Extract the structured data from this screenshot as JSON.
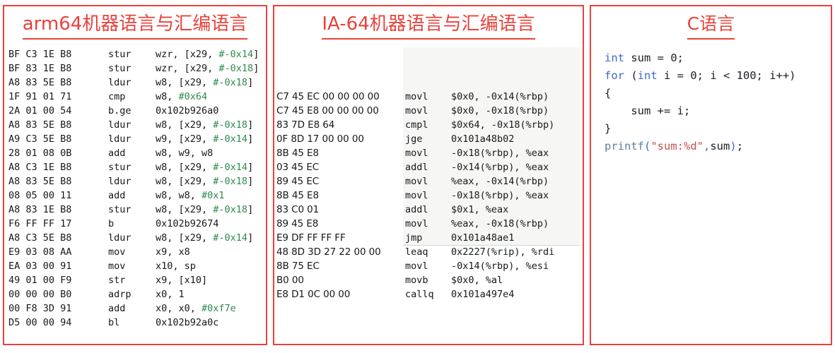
{
  "panels": {
    "arm64": {
      "title": "arm64机器语言与汇编语言",
      "lines": [
        {
          "hex": "BF C3 1E B8",
          "mnem": "stur",
          "ops": "wzr, [x29, ",
          "imm": "#-0x14",
          "tail": "]"
        },
        {
          "hex": "BF 83 1E B8",
          "mnem": "stur",
          "ops": "wzr, [x29, ",
          "imm": "#-0x18",
          "tail": "]"
        },
        {
          "hex": "A8 83 5E B8",
          "mnem": "ldur",
          "ops": "w8, [x29, ",
          "imm": "#-0x18",
          "tail": "]"
        },
        {
          "hex": "1F 91 01 71",
          "mnem": "cmp",
          "ops": "w8, ",
          "imm": "#0x64",
          "tail": ""
        },
        {
          "hex": "2A 01 00 54",
          "mnem": "b.ge",
          "ops": "0x102b926a0",
          "imm": "",
          "tail": ""
        },
        {
          "hex": "A8 83 5E B8",
          "mnem": "ldur",
          "ops": "w8, [x29, ",
          "imm": "#-0x18",
          "tail": "]"
        },
        {
          "hex": "A9 C3 5E B8",
          "mnem": "ldur",
          "ops": "w9, [x29, ",
          "imm": "#-0x14",
          "tail": "]"
        },
        {
          "hex": "28 01 08 0B",
          "mnem": "add",
          "ops": "w8, w9, w8",
          "imm": "",
          "tail": ""
        },
        {
          "hex": "A8 C3 1E B8",
          "mnem": "stur",
          "ops": "w8, [x29, ",
          "imm": "#-0x14",
          "tail": "]"
        },
        {
          "hex": "A8 83 5E B8",
          "mnem": "ldur",
          "ops": "w8, [x29, ",
          "imm": "#-0x18",
          "tail": "]"
        },
        {
          "hex": "08 05 00 11",
          "mnem": "add",
          "ops": "w8, w8, ",
          "imm": "#0x1",
          "tail": ""
        },
        {
          "hex": "A8 83 1E B8",
          "mnem": "stur",
          "ops": "w8, [x29, ",
          "imm": "#-0x18",
          "tail": "]"
        },
        {
          "hex": "F6 FF FF 17",
          "mnem": "b",
          "ops": "0x102b92674",
          "imm": "",
          "tail": ""
        },
        {
          "hex": "A8 C3 5E B8",
          "mnem": "ldur",
          "ops": "w8, [x29, ",
          "imm": "#-0x14",
          "tail": "]"
        },
        {
          "hex": "E9 03 08 AA",
          "mnem": "mov",
          "ops": "x9, x8",
          "imm": "",
          "tail": ""
        },
        {
          "hex": "EA 03 00 91",
          "mnem": "mov",
          "ops": "x10, sp",
          "imm": "",
          "tail": ""
        },
        {
          "hex": "49 01 00 F9",
          "mnem": "str",
          "ops": "x9, [x10]",
          "imm": "",
          "tail": ""
        },
        {
          "hex": "00 00 00 B0",
          "mnem": "adrp",
          "ops": "x0, 1",
          "imm": "",
          "tail": ""
        },
        {
          "hex": "00 F8 3D 91",
          "mnem": "add",
          "ops": "x0, x0, ",
          "imm": "#0xf7e",
          "tail": ""
        },
        {
          "hex": "D5 00 00 94",
          "mnem": "bl",
          "ops": "0x102b92a0c",
          "imm": "",
          "tail": ""
        }
      ]
    },
    "ia64": {
      "title": "IA-64机器语言与汇编语言",
      "lines": [
        {
          "hex": "C7 45 EC 00 00 00 00",
          "mnem": "movl",
          "ops": "$0x0, -0x14(%rbp)"
        },
        {
          "hex": "C7 45 E8 00 00 00 00",
          "mnem": "movl",
          "ops": "$0x0, -0x18(%rbp)"
        },
        {
          "hex": "83 7D E8 64",
          "mnem": "cmpl",
          "ops": "$0x64, -0x18(%rbp)"
        },
        {
          "hex": "0F 8D 17 00 00 00",
          "mnem": "jge",
          "ops": "0x101a48b02"
        },
        {
          "hex": "8B 45 E8",
          "mnem": "movl",
          "ops": "-0x18(%rbp), %eax"
        },
        {
          "hex": "03 45 EC",
          "mnem": "addl",
          "ops": "-0x14(%rbp), %eax"
        },
        {
          "hex": "89 45 EC",
          "mnem": "movl",
          "ops": "%eax, -0x14(%rbp)"
        },
        {
          "hex": "8B 45 E8",
          "mnem": "movl",
          "ops": "-0x18(%rbp), %eax"
        },
        {
          "hex": "83 C0 01",
          "mnem": "addl",
          "ops": "$0x1, %eax"
        },
        {
          "hex": "89 45 E8",
          "mnem": "movl",
          "ops": "%eax, -0x18(%rbp)"
        },
        {
          "hex": "E9 DF FF FF FF",
          "mnem": "jmp",
          "ops": "0x101a48ae1"
        },
        {
          "hex": "48 8D 3D 27 22 00 00",
          "mnem": "leaq",
          "ops": "0x2227(%rip), %rdi"
        },
        {
          "hex": "8B 75 EC",
          "mnem": "movl",
          "ops": "-0x14(%rbp), %esi"
        },
        {
          "hex": "B0 00",
          "mnem": "movb",
          "ops": "$0x0, %al"
        },
        {
          "hex": "E8 D1 0C 00 00",
          "mnem": "callq",
          "ops": "0x101a497e4"
        }
      ]
    },
    "c": {
      "title": "C语言",
      "lines": [
        [
          {
            "t": "int",
            "c": "kw"
          },
          {
            "t": " sum = 0;",
            "c": ""
          }
        ],
        [
          {
            "t": "for",
            "c": "kw"
          },
          {
            "t": " (",
            "c": ""
          },
          {
            "t": "int",
            "c": "kw"
          },
          {
            "t": " i = 0; i < 100; i++)",
            "c": ""
          }
        ],
        [
          {
            "t": "{",
            "c": ""
          }
        ],
        [
          {
            "t": "    sum += i;",
            "c": ""
          }
        ],
        [
          {
            "t": "}",
            "c": ""
          }
        ],
        [
          {
            "t": "printf",
            "c": "fn"
          },
          {
            "t": "(",
            "c": "punct"
          },
          {
            "t": "\"sum:%d\"",
            "c": "str"
          },
          {
            "t": ",",
            "c": "punct"
          },
          {
            "t": "sum",
            "c": ""
          },
          {
            "t": ")",
            "c": "punct"
          },
          {
            "t": ";",
            "c": ""
          }
        ]
      ]
    }
  },
  "colors": {
    "panel_border": "#e8423c",
    "title": "#e8423c",
    "immediate_green": "#2f8b4e",
    "keyword_blue": "#4169c8",
    "function_blue": "#5d82a0",
    "string_red": "#c4504c",
    "code_text": "#15181c",
    "ia64_block_bg": "#f6f6f4"
  }
}
